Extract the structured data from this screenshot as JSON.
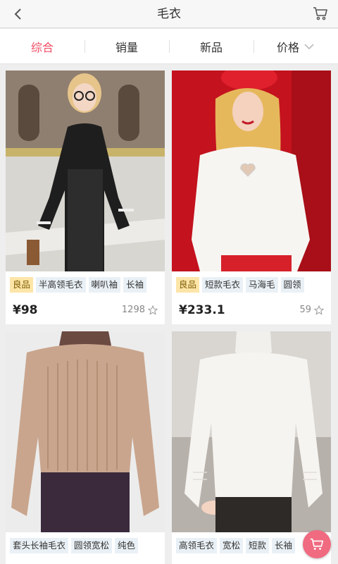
{
  "header": {
    "title": "毛衣",
    "back_icon": "chevron-left-icon",
    "cart_icon": "cart-icon"
  },
  "sort_tabs": [
    {
      "label": "综合",
      "active": true
    },
    {
      "label": "销量",
      "active": false
    },
    {
      "label": "新品",
      "active": false
    },
    {
      "label": "价格",
      "active": false,
      "icon": "chevron-down-icon"
    }
  ],
  "products": [
    {
      "tags": [
        "良品",
        "半高领毛衣",
        "喇叭袖",
        "长袖"
      ],
      "price": "¥98",
      "likes": "1298"
    },
    {
      "tags": [
        "良品",
        "短款毛衣",
        "马海毛",
        "圆领"
      ],
      "price": "¥233.1",
      "likes": "59"
    },
    {
      "tags": [
        "套头长袖毛衣",
        "圆领宽松",
        "纯色"
      ]
    },
    {
      "tags": [
        "高领毛衣",
        "宽松",
        "短款",
        "长袖"
      ]
    }
  ],
  "colors": {
    "accent": "#f04b64",
    "fab": "#f06a80",
    "good_tag_bg": "#fde5a8",
    "tag_bg": "#eaf1f6"
  },
  "fab_icon": "cart-icon"
}
